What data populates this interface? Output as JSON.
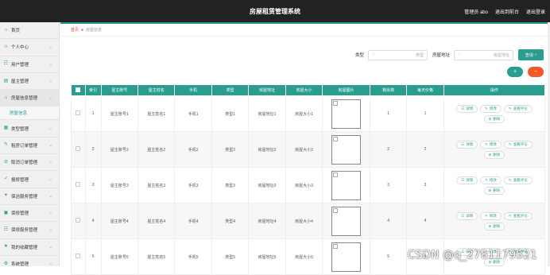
{
  "header": {
    "title": "房屋租赁管理系统",
    "user": "管理员 abo",
    "to_front": "退出到前台",
    "logout": "退出登录"
  },
  "sidebar": {
    "items": [
      {
        "label": "首页",
        "icon": "home-icon"
      },
      {
        "label": "个人中心",
        "icon": "user-icon"
      },
      {
        "label": "用户管理",
        "icon": "users-icon"
      },
      {
        "label": "屋主管理",
        "icon": "owner-icon"
      },
      {
        "label": "房屋信息管理",
        "icon": "house-icon",
        "active": true
      },
      {
        "label": "房屋信息",
        "sub": true
      },
      {
        "label": "类型管理",
        "icon": "type-icon"
      },
      {
        "label": "租房订单管理",
        "icon": "order-icon"
      },
      {
        "label": "取消订单管理",
        "icon": "cancel-icon"
      },
      {
        "label": "报修管理",
        "icon": "repair-icon"
      },
      {
        "label": "保洁服务管理",
        "icon": "clean-icon"
      },
      {
        "label": "保修管理",
        "icon": "warranty-icon"
      },
      {
        "label": "保修服务管理",
        "icon": "service-icon"
      },
      {
        "label": "我的收藏管理",
        "icon": "favorite-icon"
      },
      {
        "label": "系统管理",
        "icon": "settings-icon"
      }
    ]
  },
  "breadcrumb": {
    "home": "首页",
    "current": "房屋信息"
  },
  "search": {
    "type_label": "类型",
    "type_placeholder": "类型",
    "address_label": "房屋地址",
    "address_placeholder": "房屋地址",
    "search_button": "查询"
  },
  "table": {
    "headers": [
      "索引",
      "屋主账号",
      "屋主姓名",
      "手机",
      "类型",
      "房屋地址",
      "房屋大小",
      "房屋图片",
      "剩余数",
      "每天价格",
      "操作"
    ],
    "rows": [
      {
        "idx": "1",
        "account": "屋主账号1",
        "name": "屋主姓名1",
        "phone": "手机1",
        "type": "类型1",
        "address": "房屋地址1",
        "size": "房屋大小1",
        "remain": "1",
        "price": "1"
      },
      {
        "idx": "2",
        "account": "屋主账号2",
        "name": "屋主姓名2",
        "phone": "手机2",
        "type": "类型2",
        "address": "房屋地址2",
        "size": "房屋大小2",
        "remain": "2",
        "price": "2"
      },
      {
        "idx": "3",
        "account": "屋主账号3",
        "name": "屋主姓名3",
        "phone": "手机3",
        "type": "类型3",
        "address": "房屋地址3",
        "size": "房屋大小3",
        "remain": "3",
        "price": "3"
      },
      {
        "idx": "4",
        "account": "屋主账号4",
        "name": "屋主姓名4",
        "phone": "手机4",
        "type": "类型4",
        "address": "房屋地址4",
        "size": "房屋大小4",
        "remain": "4",
        "price": "4"
      },
      {
        "idx": "5",
        "account": "屋主账号5",
        "name": "屋主姓名5",
        "phone": "手机5",
        "type": "类型5",
        "address": "房屋地址5",
        "size": "房屋大小5",
        "remain": "5",
        "price": "5"
      }
    ],
    "actions": {
      "detail": "详情",
      "edit": "修改",
      "review": "查看评论",
      "delete": "删除"
    }
  },
  "watermark": "CSDN @q_2781179521",
  "colors": {
    "accent": "#2a9d8f",
    "danger": "#f05a28",
    "topbar": "#222222"
  }
}
